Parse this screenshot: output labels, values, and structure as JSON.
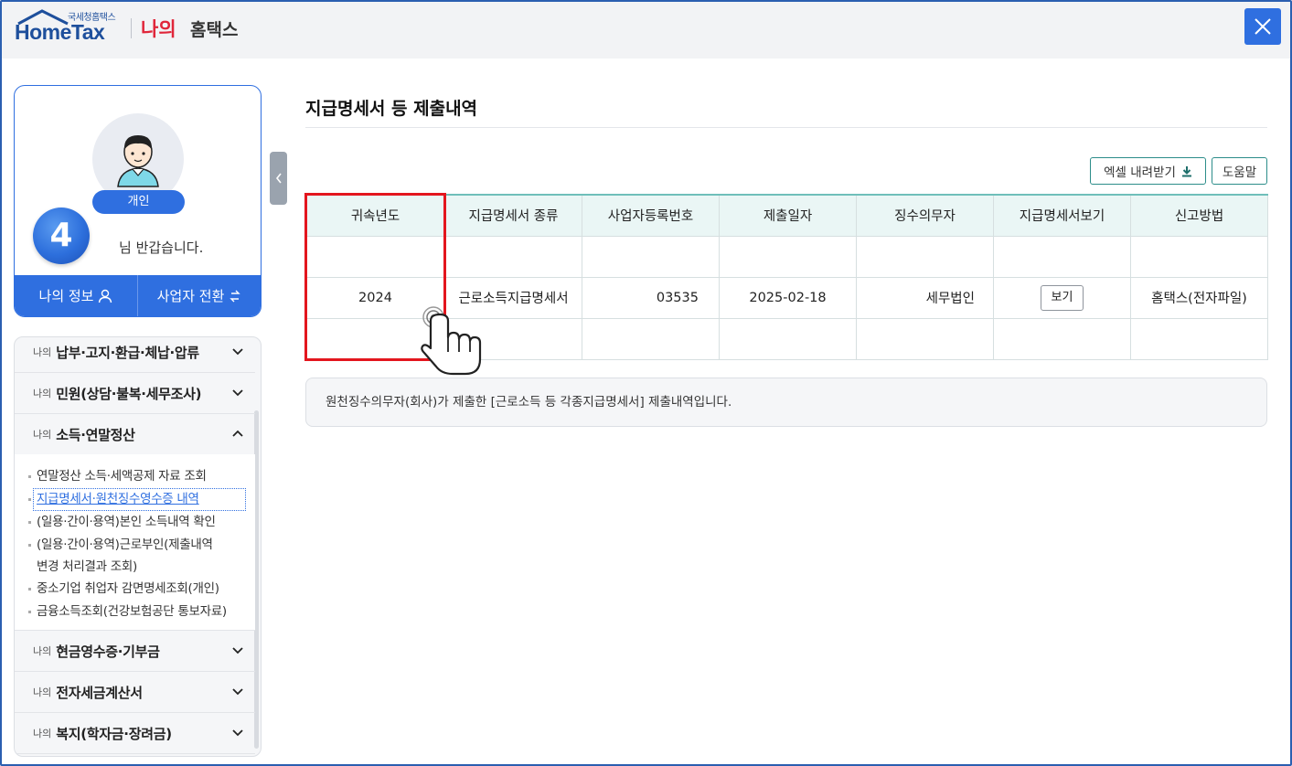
{
  "header": {
    "logo_sub": "국세청홈택스",
    "logo_main": "HomeTax",
    "my_label": "나의",
    "home_label": "홈택스",
    "close_icon": "close-icon"
  },
  "profile": {
    "badge": "개인",
    "step_number": "4",
    "welcome": "님 반갑습니다.",
    "my_info": "나의 정보",
    "switch_business": "사업자 전환"
  },
  "menu": {
    "items": [
      {
        "prefix": "나의",
        "title": "납부·고지·환급·체납·압류"
      },
      {
        "prefix": "나의",
        "title": "민원(상담·불복·세무조사)"
      },
      {
        "prefix": "나의",
        "title": "소득·연말정산"
      },
      {
        "prefix": "나의",
        "title": "현금영수증·기부금"
      },
      {
        "prefix": "나의",
        "title": "전자세금계산서"
      },
      {
        "prefix": "나의",
        "title": "복지(학자금·장려금)"
      }
    ],
    "submenu": [
      "연말정산 소득·세액공제 자료 조회",
      "지급명세서·원천징수영수증 내역",
      "(일용·간이·용역)본인 소득내역 확인",
      "(일용·간이·용역)근로부인(제출내역",
      "변경 처리결과 조회)",
      "중소기업 취업자 감면명세조회(개인)",
      "금융소득조회(건강보험공단 통보자료)"
    ]
  },
  "main": {
    "title": "지급명세서 등 제출내역",
    "excel_button": "엑셀 내려받기",
    "help_button": "도움말",
    "columns": [
      "귀속년도",
      "지급명세서 종류",
      "사업자등록번호",
      "제출일자",
      "징수의무자",
      "지급명세서보기",
      "신고방법"
    ],
    "rows": [
      {
        "year": "2024",
        "type": "근로소득지급명세서",
        "biz_no": "03535",
        "date": "2025-02-18",
        "payer": "세무법인",
        "view": "보기",
        "method": "홈택스(전자파일)"
      }
    ],
    "notice": "원천징수의무자(회사)가 제출한 [근로소득 등 각종지급명세서] 제출내역입니다."
  },
  "colors": {
    "brand_blue": "#2f6fe0",
    "highlight_red": "#e3161e",
    "table_head": "#eaf6f5",
    "logo_red": "#e0263a"
  }
}
